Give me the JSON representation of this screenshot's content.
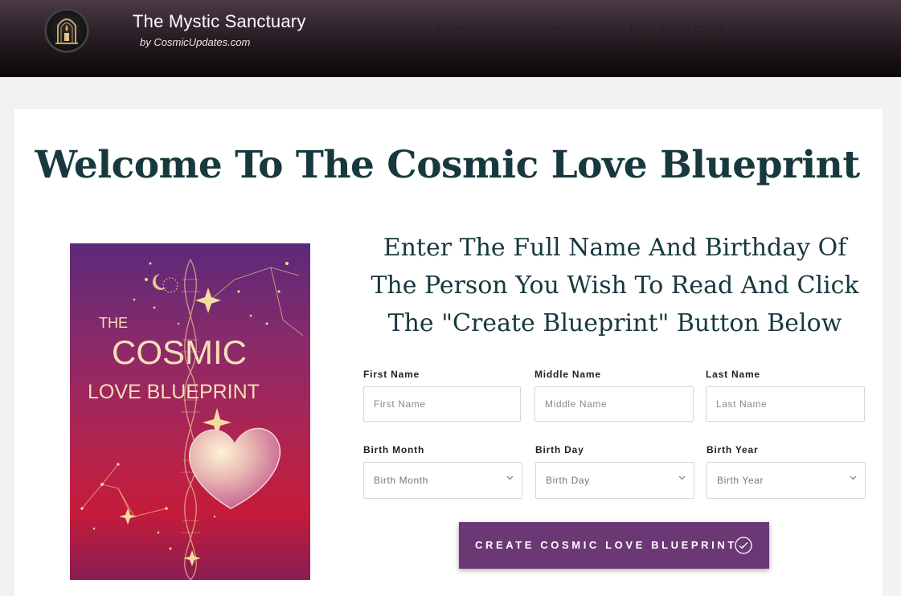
{
  "header": {
    "brand_title": "The Mystic Sanctuary",
    "brand_subtitle": "by CosmicUpdates.com",
    "nav": [
      {
        "label": "Home"
      },
      {
        "label": "Products"
      },
      {
        "label": "Free Tarot Chat"
      },
      {
        "label": "Get Help"
      }
    ]
  },
  "main": {
    "title": "Welcome To The Cosmic Love Blueprint",
    "instructions": "Enter The Full Name And Birthday Of The Person You Wish To Read And Click The \"Create Blueprint\" Button Below"
  },
  "cover": {
    "line1": "THE",
    "line2": "COSMIC",
    "line3": "LOVE BLUEPRINT"
  },
  "form": {
    "first_name": {
      "label": "First Name",
      "placeholder": "First Name",
      "value": ""
    },
    "middle_name": {
      "label": "Middle Name",
      "placeholder": "Middle Name",
      "value": ""
    },
    "last_name": {
      "label": "Last Name",
      "placeholder": "Last Name",
      "value": ""
    },
    "birth_month": {
      "label": "Birth Month",
      "selected": "Birth Month"
    },
    "birth_day": {
      "label": "Birth Day",
      "selected": "Birth Day"
    },
    "birth_year": {
      "label": "Birth Year",
      "selected": "Birth Year"
    },
    "submit_label": "CREATE COSMIC LOVE BLUEPRINT"
  },
  "icons": {
    "logo": "candle-arch-logo",
    "products_dropdown": "chevron-down-icon",
    "select_arrow": "chevron-down-icon",
    "cta": "check-circle-icon"
  },
  "colors": {
    "title": "#17393e",
    "cta_background": "#6b3875",
    "header_background": "#1a1216"
  }
}
